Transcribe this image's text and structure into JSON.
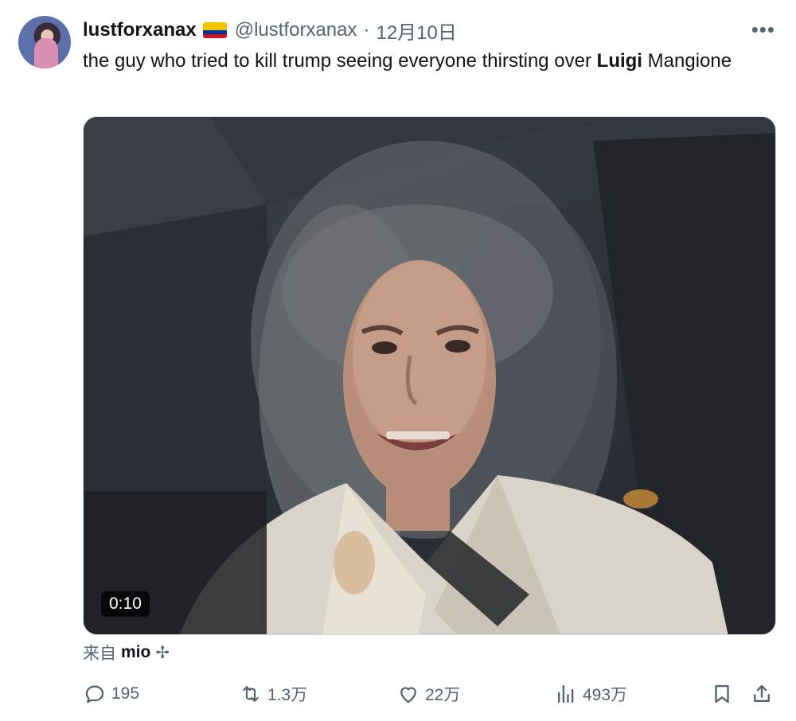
{
  "tweet": {
    "display_name": "lustforxanax",
    "handle": "@lustforxanax",
    "separator": "·",
    "date": "12月10日",
    "more_label": "•••",
    "text_before": "the guy who tried to kill trump seeing everyone thirsting over ",
    "text_bold": "Luigi",
    "text_after": " Mangione",
    "flag_colors": [
      "#f4c300",
      "#003893",
      "#ce1126"
    ]
  },
  "media": {
    "duration": "0:10"
  },
  "source": {
    "prefix": "来自",
    "name": "mio",
    "suffix": "✢"
  },
  "actions": {
    "replies": "195",
    "retweets": "1.3万",
    "likes": "22万",
    "views": "493万"
  },
  "icons": {
    "reply": "comment-icon",
    "retweet": "retweet-icon",
    "like": "heart-icon",
    "views": "analytics-icon",
    "bookmark": "bookmark-icon",
    "share": "share-icon"
  }
}
